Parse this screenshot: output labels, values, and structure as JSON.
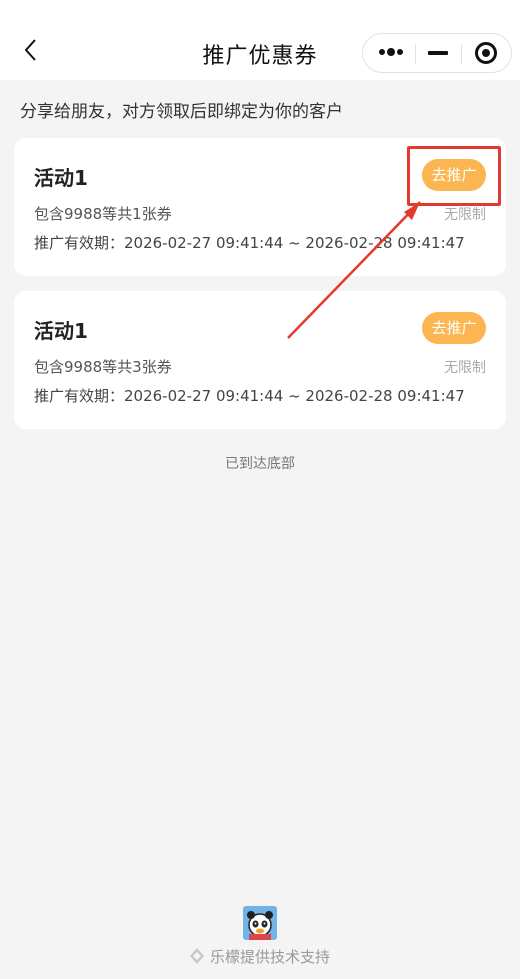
{
  "navbar": {
    "title": "推广优惠券",
    "back_icon": "chevron-left-icon",
    "capsule": {
      "more_icon": "more-dots-icon",
      "minimize_icon": "minus-icon",
      "close_icon": "target-icon"
    }
  },
  "share_tip": "分享给朋友，对方领取后即绑定为你的客户",
  "cards": [
    {
      "title": "活动1",
      "promote_label": "去推广",
      "count_text": "包含9988等共1张券",
      "limit_text": "无限制",
      "period_text": "推广有效期：2026-02-27 09:41:44 ~ 2026-02-28 09:41:47"
    },
    {
      "title": "活动1",
      "promote_label": "去推广",
      "count_text": "包含9988等共3张券",
      "limit_text": "无限制",
      "period_text": "推广有效期：2026-02-27 09:41:44 ~ 2026-02-28 09:41:47"
    }
  ],
  "end_text": "已到达底部",
  "footer": {
    "support_text": "乐檬提供技术支持",
    "avatar_icon": "panda-avatar-icon",
    "logo_icon": "diamond-logo-icon"
  },
  "colors": {
    "accent": "#fcb651",
    "highlight": "#e23b2e",
    "background": "#f4f4f4"
  }
}
